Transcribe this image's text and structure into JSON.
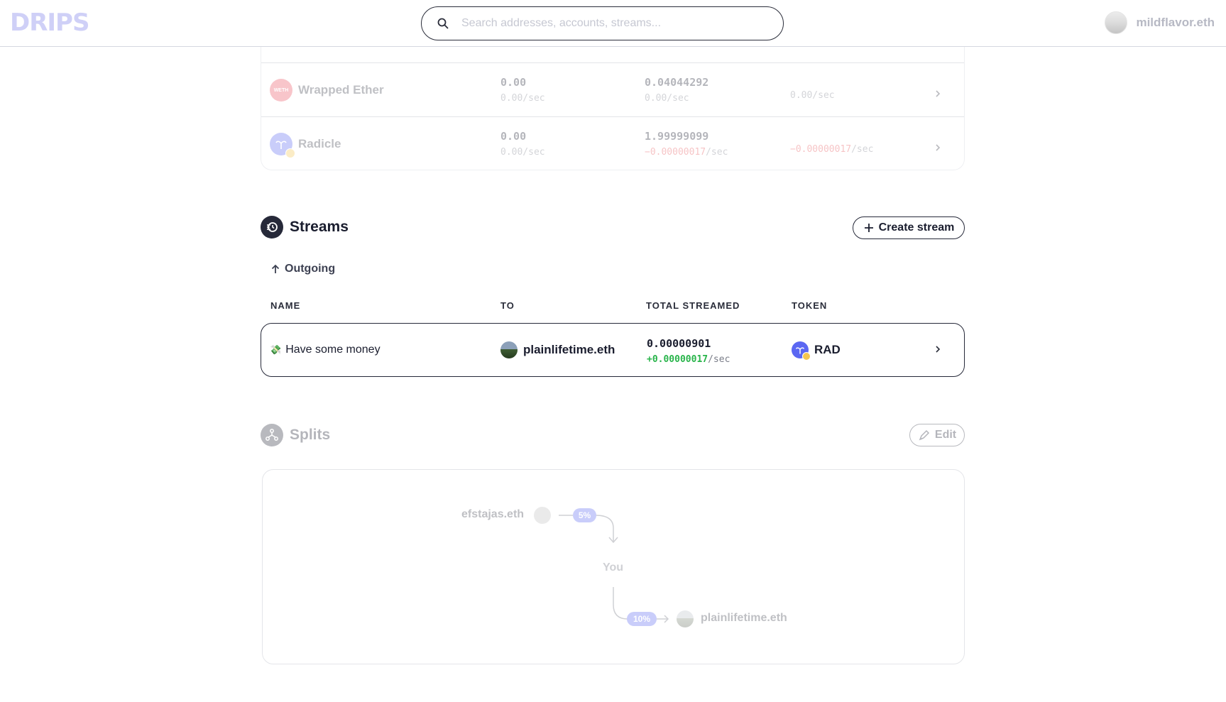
{
  "header": {
    "logo": "DRIPS",
    "search_placeholder": "Search addresses, accounts, streams...",
    "username": "mildflavor.eth"
  },
  "balances": {
    "rows": [
      {
        "icon": "weth-token-icon",
        "icon_text": "WETH",
        "name": "Wrapped Ether",
        "col1_value": "0.00",
        "col1_rate": "0.00/sec",
        "col2_value": "0.04044292",
        "col2_rate": "0.00/sec",
        "net_rate": "0.00/sec"
      },
      {
        "icon": "radicle-token-icon",
        "name": "Radicle",
        "col1_value": "0.00",
        "col1_rate": "0.00/sec",
        "col2_value": "1.99999099",
        "col2_rate_value": "−0.00000017",
        "col2_rate_unit": "/sec",
        "net_rate_value": "−0.00000017",
        "net_rate_unit": "/sec"
      }
    ]
  },
  "streams": {
    "title": "Streams",
    "create_button": "Create stream",
    "outgoing_label": "Outgoing",
    "columns": {
      "name": "NAME",
      "to": "TO",
      "total": "TOTAL STREAMED",
      "token": "TOKEN"
    },
    "row": {
      "emoji": "💸",
      "name": "Have some money",
      "to": "plainlifetime.eth",
      "total": "0.00000901",
      "rate_value": "+0.00000017",
      "rate_unit": "/sec",
      "token": "RAD"
    }
  },
  "splits": {
    "title": "Splits",
    "edit_button": "Edit",
    "incoming_from": "efstajas.eth",
    "incoming_pct": "5%",
    "center_label": "You",
    "outgoing_pct": "10%",
    "outgoing_to": "plainlifetime.eth"
  },
  "colors": {
    "accent": "#5b67f2",
    "positive": "#28b44a",
    "negative": "#e5484d",
    "dark": "#262939"
  }
}
